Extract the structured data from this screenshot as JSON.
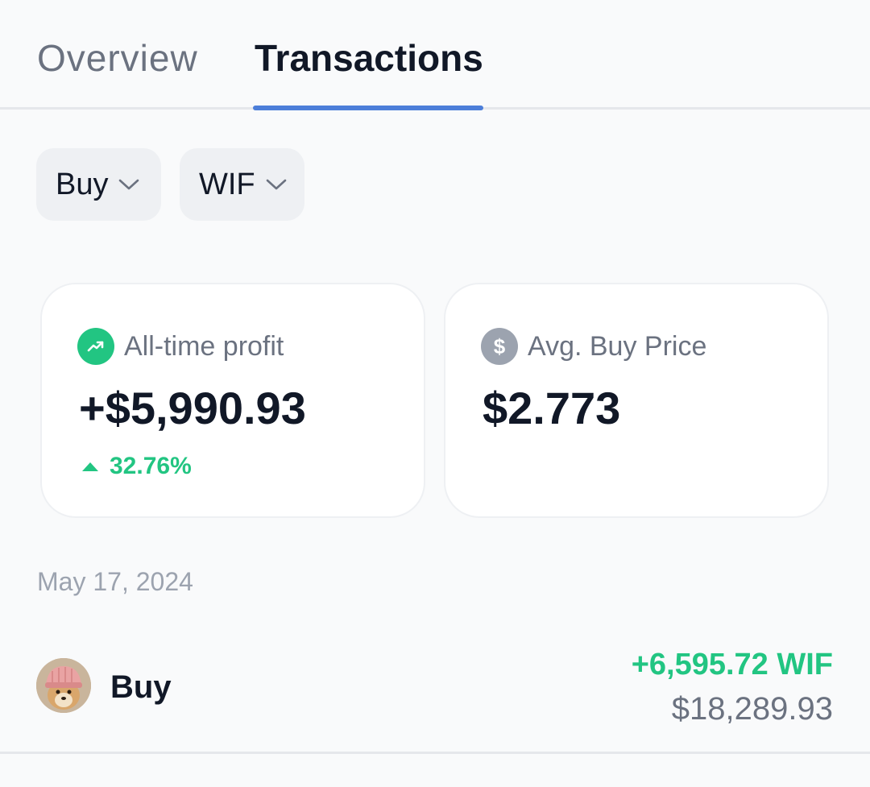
{
  "tabs": {
    "overview": "Overview",
    "transactions": "Transactions",
    "active": "transactions",
    "underline_color": "#4c7ed9"
  },
  "filters": {
    "action": {
      "value": "Buy",
      "icon": "chevron-down-icon"
    },
    "token": {
      "value": "WIF",
      "icon": "chevron-down-icon"
    }
  },
  "cards": {
    "profit": {
      "icon": "trending-up-icon",
      "title": "All-time profit",
      "value": "+$5,990.93",
      "change": "32.76%",
      "change_direction": "up",
      "color": "#22c582"
    },
    "avg_price": {
      "icon": "dollar-icon",
      "icon_glyph": "$",
      "title": "Avg. Buy Price",
      "value": "$2.773"
    }
  },
  "transactions": {
    "groups": [
      {
        "date": "May 17, 2024",
        "items": [
          {
            "type": "Buy",
            "avatar": "wif-token-avatar",
            "amount": "+6,595.72 WIF",
            "usd_value": "$18,289.93"
          }
        ]
      }
    ]
  },
  "colors": {
    "positive": "#22c582",
    "muted_text": "#6b7280",
    "primary_text": "#111827"
  }
}
